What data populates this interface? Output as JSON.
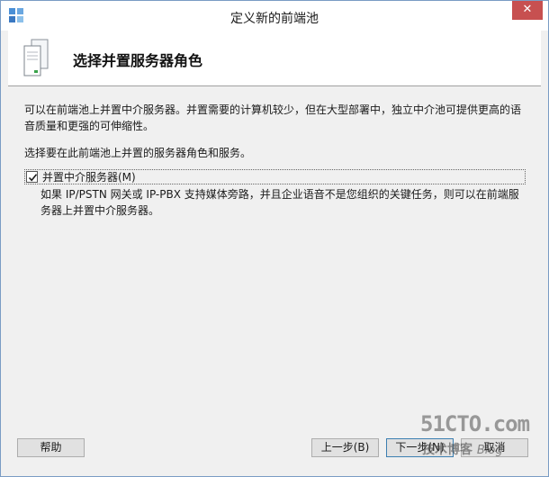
{
  "window": {
    "title": "定义新的前端池"
  },
  "header": {
    "title": "选择并置服务器角色"
  },
  "content": {
    "intro": "可以在前端池上并置中介服务器。并置需要的计算机较少，但在大型部署中，独立中介池可提供更高的语音质量和更强的可伸缩性。",
    "prompt": "选择要在此前端池上并置的服务器角色和服务。",
    "option": {
      "label": "并置中介服务器(M)",
      "checked": true,
      "description": "如果 IP/PSTN 网关或 IP-PBX 支持媒体旁路，并且企业语音不是您组织的关键任务，则可以在前端服务器上并置中介服务器。"
    }
  },
  "buttons": {
    "help": "帮助",
    "back": "上一步(B)",
    "next": "下一步(N)",
    "cancel": "取消"
  },
  "watermark": {
    "brand": "51CTO.com",
    "tagline": "技术博客",
    "blog": "Blog"
  },
  "icons": {
    "app": "app-icon",
    "header": "server-icon",
    "close": "close-icon",
    "check": "checkmark-icon"
  }
}
